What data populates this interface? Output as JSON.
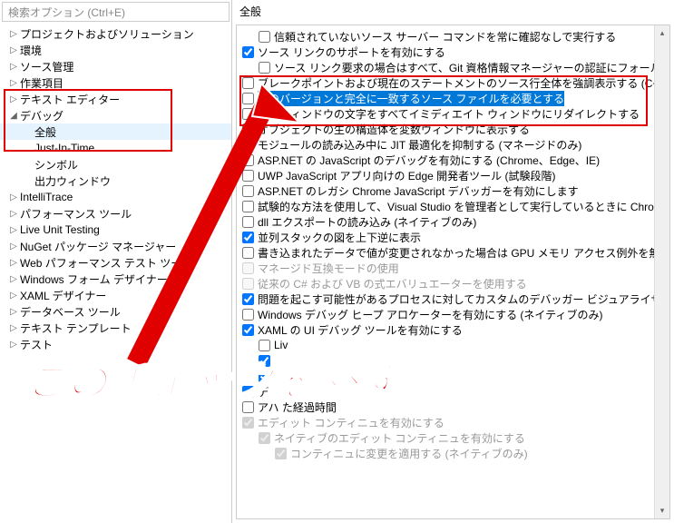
{
  "search": {
    "placeholder": "検索オプション (Ctrl+E)"
  },
  "tree": {
    "items": [
      {
        "label": "プロジェクトおよびソリューション",
        "arrow": "▷"
      },
      {
        "label": "環境",
        "arrow": "▷"
      },
      {
        "label": "ソース管理",
        "arrow": "▷"
      },
      {
        "label": "作業項目",
        "arrow": "▷"
      },
      {
        "label": "テキスト エディター",
        "arrow": "▷"
      },
      {
        "label": "デバッグ",
        "arrow": "◢"
      },
      {
        "label": "全般",
        "child": true,
        "selected": true
      },
      {
        "label": "Just-In-Time",
        "child": true
      },
      {
        "label": "シンボル",
        "child": true
      },
      {
        "label": "出力ウィンドウ",
        "child": true
      },
      {
        "label": "IntelliTrace",
        "arrow": "▷"
      },
      {
        "label": "パフォーマンス ツール",
        "arrow": "▷"
      },
      {
        "label": "Live Unit Testing",
        "arrow": "▷"
      },
      {
        "label": "NuGet パッケージ マネージャー",
        "arrow": "▷"
      },
      {
        "label": "Web パフォーマンス テスト ツール",
        "arrow": "▷"
      },
      {
        "label": "Windows フォーム デザイナー",
        "arrow": "▷"
      },
      {
        "label": "XAML デザイナー",
        "arrow": "▷"
      },
      {
        "label": "データベース ツール",
        "arrow": "▷"
      },
      {
        "label": "テキスト テンプレート",
        "arrow": "▷"
      },
      {
        "label": "テスト",
        "arrow": "▷"
      }
    ]
  },
  "right": {
    "header": "全般"
  },
  "options": [
    {
      "indent": 1,
      "checked": false,
      "label": "信頼されていないソース サーバー コマンドを常に確認なしで実行する"
    },
    {
      "indent": 0,
      "checked": true,
      "label": "ソース リンクのサポートを有効にする"
    },
    {
      "indent": 1,
      "checked": false,
      "label": "ソース リンク要求の場合はすべて、Git 資格情報マネージャーの認証にフォールバックし"
    },
    {
      "indent": 0,
      "checked": false,
      "label": "ブレークポイントおよび現在のステートメントのソース行全体を強調表示する (C++ のみ)"
    },
    {
      "indent": 0,
      "checked": false,
      "label": "元のバージョンと完全に一致するソース ファイルを必要とする",
      "highlight": true
    },
    {
      "indent": 0,
      "checked": false,
      "label": "出力ウィンドウの文字をすべてイミディエイト ウィンドウにリダイレクトする"
    },
    {
      "indent": 0,
      "checked": false,
      "label": "オブジェクトの生の構造体を変数ウィンドウに表示する"
    },
    {
      "indent": 0,
      "checked": false,
      "label": "モジュールの読み込み中に JIT 最適化を抑制する (マネージドのみ)"
    },
    {
      "indent": 0,
      "checked": false,
      "label": "ASP.NET の JavaScript のデバッグを有効にする (Chrome、Edge、IE)"
    },
    {
      "indent": 0,
      "checked": false,
      "label": "UWP JavaScript アプリ向けの Edge 開発者ツール (試験段階)"
    },
    {
      "indent": 0,
      "checked": false,
      "label": "ASP.NET のレガシ Chrome JavaScript デバッガーを有効にします"
    },
    {
      "indent": 0,
      "checked": false,
      "label": "試験的な方法を使用して、Visual Studio を管理者として実行しているときに Chrome"
    },
    {
      "indent": 0,
      "checked": false,
      "label": "dll エクスポートの読み込み (ネイティブのみ)"
    },
    {
      "indent": 0,
      "checked": true,
      "label": "並列スタックの図を上下逆に表示"
    },
    {
      "indent": 0,
      "checked": false,
      "label": "書き込まれたデータで値が変更されなかった場合は GPU メモリ アクセス例外を無視する"
    },
    {
      "indent": 0,
      "checked": false,
      "label": "マネージド互換モードの使用",
      "disabled": true
    },
    {
      "indent": 0,
      "checked": false,
      "label": "従来の C# および VB の式エバリュエーターを使用する",
      "disabled": true
    },
    {
      "indent": 0,
      "checked": true,
      "label": "問題を起こす可能性があるプロセスに対してカスタムのデバッガー ビジュアライザーを使用す"
    },
    {
      "indent": 0,
      "checked": false,
      "label": "Windows デバッグ ヒープ アロケーターを有効にする (ネイティブのみ)"
    },
    {
      "indent": 0,
      "checked": true,
      "label": "XAML の UI デバッグ ツールを有効にする"
    },
    {
      "indent": 1,
      "checked": false,
      "label": "Liv"
    },
    {
      "indent": 1,
      "checked": true,
      "label": ""
    },
    {
      "indent": 1,
      "checked": true,
      "label": ""
    },
    {
      "indent": 0,
      "checked": true,
      "label": "デ"
    },
    {
      "indent": 0,
      "checked": false,
      "label": "アハ     た経過時間"
    },
    {
      "indent": 0,
      "checked": true,
      "label": "エディット コンティニュを有効にする",
      "disabled": true
    },
    {
      "indent": 1,
      "checked": true,
      "label": "ネイティブのエディット コンティニュを有効にする",
      "disabled": true
    },
    {
      "indent": 2,
      "checked": true,
      "label": "コンティニュに変更を適用する (ネイティブのみ)",
      "disabled": true
    }
  ],
  "annotation": {
    "text": "このチェックを外す"
  }
}
